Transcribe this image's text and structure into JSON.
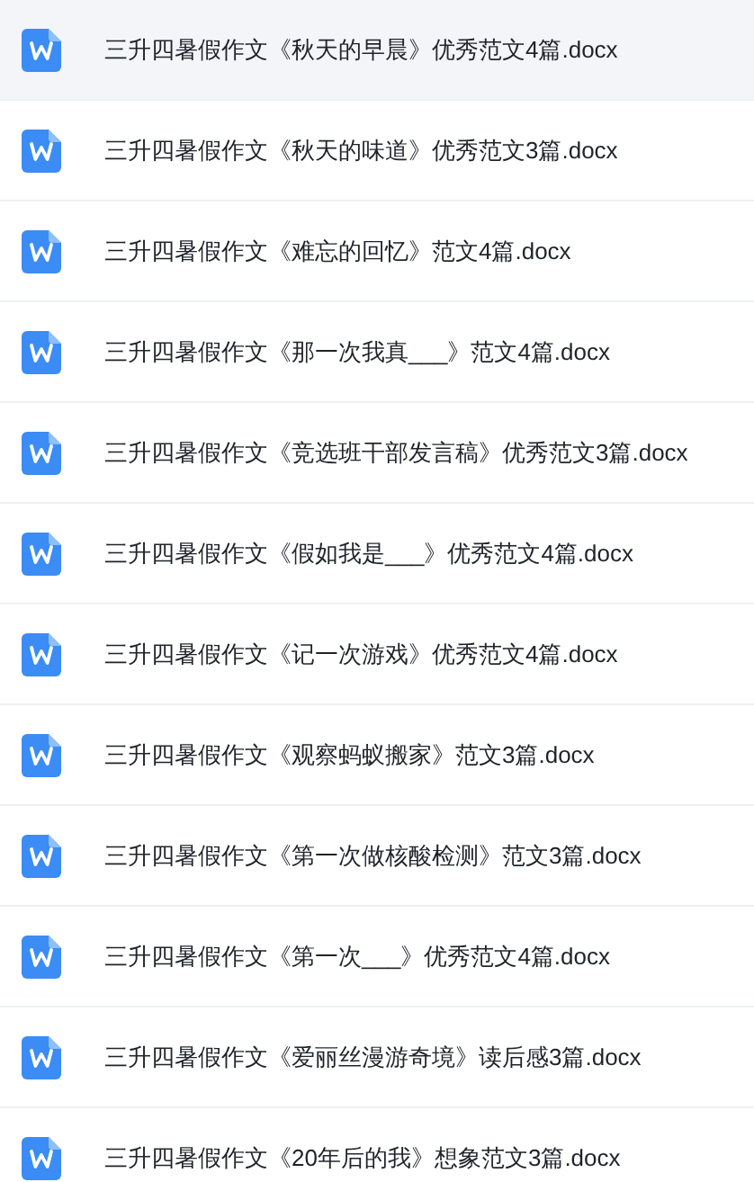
{
  "files": [
    {
      "name": "三升四暑假作文《秋天的早晨》优秀范文4篇.docx",
      "selected": true
    },
    {
      "name": "三升四暑假作文《秋天的味道》优秀范文3篇.docx",
      "selected": false
    },
    {
      "name": "三升四暑假作文《难忘的回忆》范文4篇.docx",
      "selected": false
    },
    {
      "name": "三升四暑假作文《那一次我真___》范文4篇.docx",
      "selected": false
    },
    {
      "name": "三升四暑假作文《竞选班干部发言稿》优秀范文3篇.docx",
      "selected": false
    },
    {
      "name": "三升四暑假作文《假如我是___》优秀范文4篇.docx",
      "selected": false
    },
    {
      "name": "三升四暑假作文《记一次游戏》优秀范文4篇.docx",
      "selected": false
    },
    {
      "name": "三升四暑假作文《观察蚂蚁搬家》范文3篇.docx",
      "selected": false
    },
    {
      "name": "三升四暑假作文《第一次做核酸检测》范文3篇.docx",
      "selected": false
    },
    {
      "name": "三升四暑假作文《第一次___》优秀范文4篇.docx",
      "selected": false
    },
    {
      "name": "三升四暑假作文《爱丽丝漫游奇境》读后感3篇.docx",
      "selected": false
    },
    {
      "name": "三升四暑假作文《20年后的我》想象范文3篇.docx",
      "selected": false
    }
  ]
}
